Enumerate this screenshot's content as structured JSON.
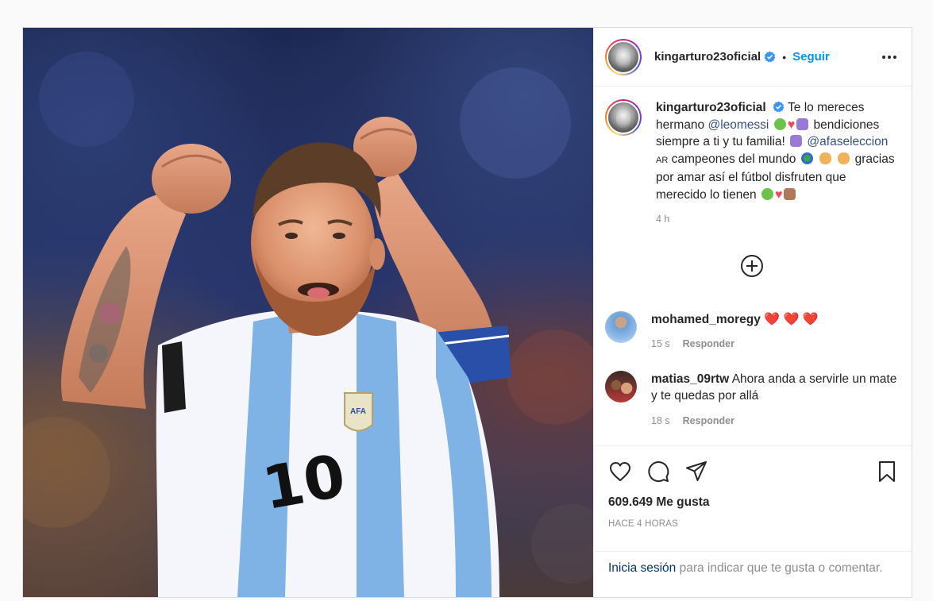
{
  "post": {
    "image_alt": "",
    "jersey_number": "10"
  },
  "header": {
    "username": "kingarturo23oficial",
    "separator": "•",
    "follow_label": "Seguir",
    "verified_icon": "verified-badge-icon",
    "more_icon": "more-options-icon"
  },
  "caption": {
    "username": "kingarturo23oficial",
    "text_1": "Te lo mereces hermano ",
    "mention_1": "@leomessi",
    "text_2": " bendiciones siempre a ti y tu familia! ",
    "mention_2": "@afaseleccion",
    "flag_text": "AR",
    "text_3": " campeones del mundo ",
    "text_4": " gracias por amar así el fútbol disfruten que merecido lo tienen ",
    "time": "4 h"
  },
  "load_more_icon": "plus-circle-icon",
  "comments": [
    {
      "username": "mohamed_moregy",
      "text": "",
      "hearts": "❤️ ❤️ ❤️",
      "time": "15 s",
      "reply_label": "Responder"
    },
    {
      "username": "matias_09rtw",
      "text": "Ahora anda a servirle un mate y te quedas por allá",
      "time": "18 s",
      "reply_label": "Responder"
    }
  ],
  "actions": {
    "like_icon": "heart-icon",
    "comment_icon": "comment-icon",
    "share_icon": "share-icon",
    "save_icon": "bookmark-icon",
    "likes": "609.649 Me gusta",
    "timestamp": "HACE 4 HORAS"
  },
  "login_prompt": {
    "link": "Inicia sesión",
    "text": " para indicar que te gusta o comentar."
  },
  "colors": {
    "link_blue": "#0095f6",
    "mention": "#385185",
    "heart": "#ed4956",
    "muted": "#8e8e8e"
  }
}
